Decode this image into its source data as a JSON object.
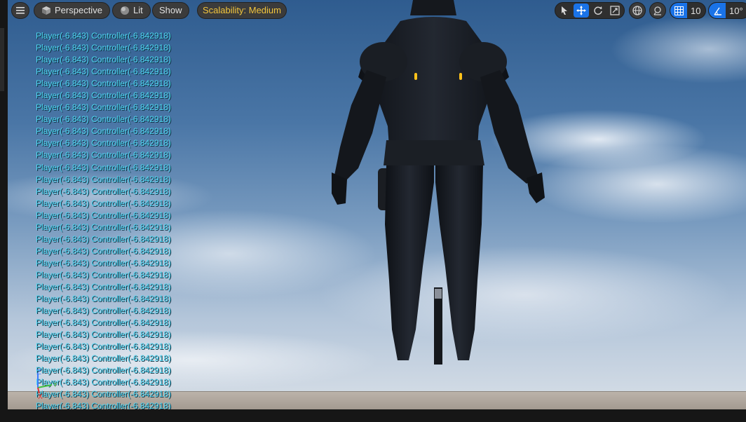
{
  "toolbar": {
    "menu_icon": "hamburger-icon",
    "perspective_label": "Perspective",
    "perspective_icon": "cube-icon",
    "lit_label": "Lit",
    "lit_icon": "sphere-icon",
    "show_label": "Show",
    "scalability_label": "Scalability: Medium",
    "scalability_color": "#f2c53d"
  },
  "transform_tools": [
    {
      "name": "select",
      "icon": "cursor-icon",
      "active": false
    },
    {
      "name": "translate",
      "icon": "move-icon",
      "active": true
    },
    {
      "name": "rotate",
      "icon": "rotate-icon",
      "active": false
    },
    {
      "name": "scale",
      "icon": "scale-icon",
      "active": false
    }
  ],
  "world_local_icon": "globe-icon",
  "surface_snap_icon": "surface-snap-icon",
  "grid_snap": {
    "icon": "grid-icon",
    "value": "10"
  },
  "rotation_snap": {
    "icon": "angle-icon",
    "value": "10°"
  },
  "accent_color": "#1a73e8",
  "debug_log": {
    "color": "#4fd6f2",
    "lines": [
      "Player(-6.843) Controller(-6.842918)",
      "Player(-6.843) Controller(-6.842918)",
      "Player(-6.843) Controller(-6.842918)",
      "Player(-6.843) Controller(-6.842918)",
      "Player(-6.843) Controller(-6.842918)",
      "Player(-6.843) Controller(-6.842918)",
      "Player(-6.843) Controller(-6.842918)",
      "Player(-6.843) Controller(-6.842918)",
      "Player(-6.843) Controller(-6.842918)",
      "Player(-6.843) Controller(-6.842918)",
      "Player(-6.843) Controller(-6.842918)",
      "Player(-6.843) Controller(-6.842918)",
      "Player(-6.843) Controller(-6.842918)",
      "Player(-6.843) Controller(-6.842918)",
      "Player(-6.843) Controller(-6.842918)",
      "Player(-6.843) Controller(-6.842918)",
      "Player(-6.843) Controller(-6.842918)",
      "Player(-6.843) Controller(-6.842918)",
      "Player(-6.843) Controller(-6.842918)",
      "Player(-6.843) Controller(-6.842918)",
      "Player(-6.843) Controller(-6.842918)",
      "Player(-6.843) Controller(-6.842918)",
      "Player(-6.843) Controller(-6.842918)",
      "Player(-6.843) Controller(-6.842918)",
      "Player(-6.843) Controller(-6.842918)",
      "Player(-6.843) Controller(-6.842918)",
      "Player(-6.843) Controller(-6.842918)",
      "Player(-6.843) Controller(-6.842918)",
      "Player(-6.843) Controller(-6.842918)",
      "Player(-6.843) Controller(-6.842918)",
      "Player(-6.843) Controller(-6.842918)",
      "Player(-6.843) Controller(-6.842918)"
    ]
  },
  "axis_gizmo": {
    "z_label": "Z",
    "x_label": "X",
    "y_label": "Y"
  },
  "scene": {
    "character": "armored-character",
    "weapon": "pistol",
    "sky": "cloudy-sky"
  }
}
